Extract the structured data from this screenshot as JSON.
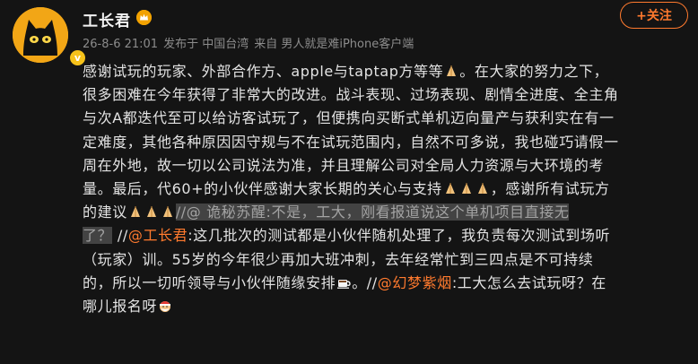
{
  "post": {
    "author": "工长君",
    "verified_badge": "v",
    "meta": {
      "datetime": "26-8-6 21:01",
      "published_at": "发布于 中国台湾",
      "source": "来自 男人就是难iPhone客户端"
    },
    "follow_label": "+关注",
    "content": {
      "l1a": "感谢试玩的玩家、外部合作方、apple与taptap方等等",
      "l1b": "。在大家的努力之下，",
      "l2": "很多困难在今年获得了非常大的改进。战斗表现、过场表现、剧情全进度、全主角",
      "l3": "与次A都迭代至可以给访客试玩了，但便携向买断式单机迈向量产与获利实在有一",
      "l4": "定难度，其他各种原因因守规与不在试玩范围内，自然不可多说，我也碰巧请假一",
      "l5": "周在外地，故一切以公司说法为准，并且理解公司对全局人力资源与大环境的考",
      "l6a": "量。最后，代60+的小伙伴感谢大家长期的关心与支持",
      "l6b": "，感谢所有试玩方",
      "l7a": "的建议",
      "l7b": "//@ 诡秘苏醒:不是，工大，刚看报道说这个单机项目直接无",
      "l8a": "了？",
      "l8b": "//",
      "l8c": "@工长君",
      "l8d": ":这几批次的测试都是小伙伴随机处理了，我负责每次测试到场听",
      "l9": "（玩家）训。55岁的今年很少再加大班冲刺，去年经常忙到三四点是不可持续",
      "l10a": "的，所以一切听领导与小伙伴随缘安排",
      "l10b": "。//",
      "l10c": "@幻梦紫烟",
      "l10d": ":工大怎么去试玩呀？在",
      "l11": "哪儿报名呀"
    }
  },
  "colors": {
    "accent": "#ff7a2e",
    "background": "#141414",
    "text": "#e3e3e3",
    "meta": "#8c8c8c",
    "quote_highlight": "#434343"
  },
  "icons": {
    "avatar": "black-cat-avatar",
    "badge": "crown-icon",
    "emoji_pray": "folded-hands-emoji",
    "emoji_coffee": "coffee-emoji",
    "emoji_santa": "santa-face-emoji"
  }
}
